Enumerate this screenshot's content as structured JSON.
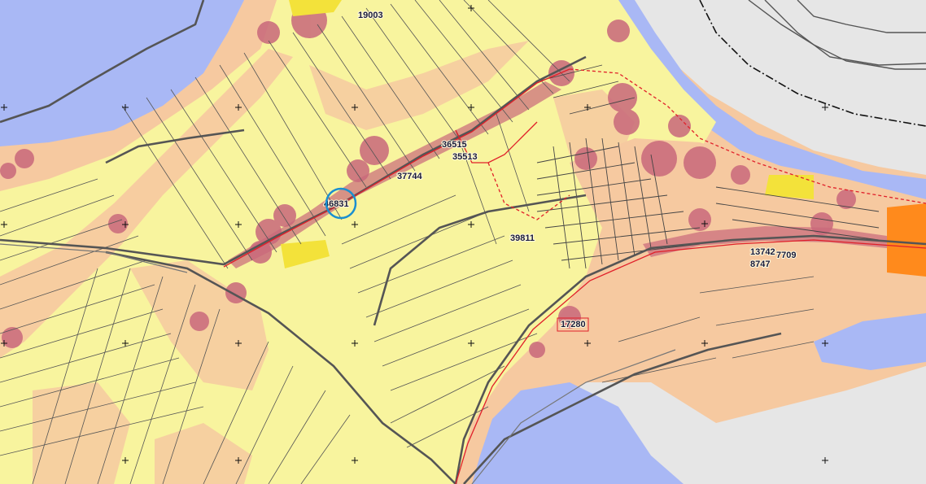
{
  "map": {
    "parcel_labels": [
      "19003",
      "36515",
      "35513",
      "37744",
      "46831",
      "39811",
      "13742",
      "8747",
      "7709",
      "17280"
    ],
    "highlighted_parcel": "46831",
    "colors": {
      "water": "#a9b8f5",
      "low_zone": "#f8f49e",
      "medium_zone": "#f6c9a0",
      "high_zone": "#c9687b",
      "yellow_zone": "#f3e23a",
      "orange_zone": "#ff8a1c",
      "built_area": "#e6e6e6",
      "road": "#555555",
      "boundary_red": "#e0202a",
      "highlight_ring": "#1a8fd0"
    }
  }
}
